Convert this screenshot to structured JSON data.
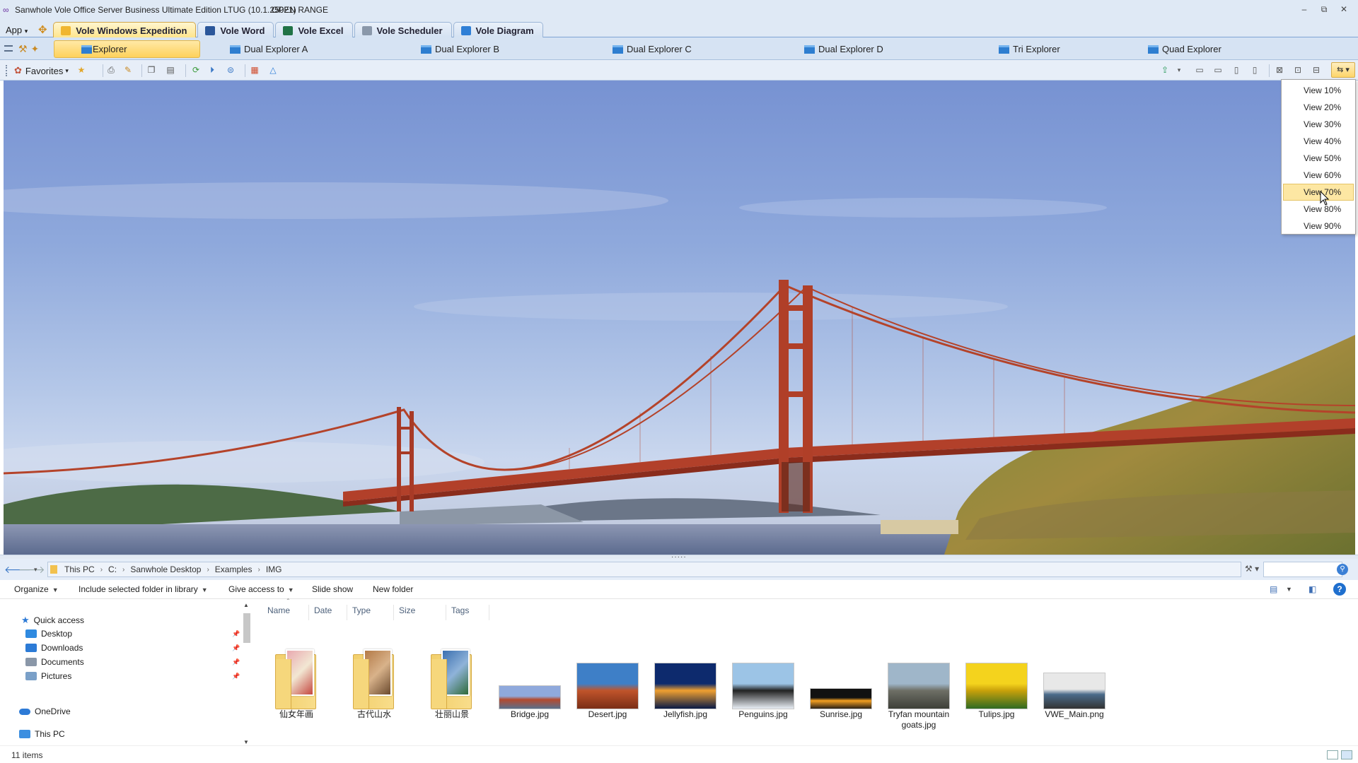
{
  "window": {
    "title": "Sanwhole Vole Office Server Business Ultimate Edition LTUG (10.1.25021)",
    "title_extra": "OPEN RANGE",
    "controls": [
      "–",
      "⧉",
      "✕"
    ]
  },
  "app_menu": {
    "label": "App",
    "caret": "▾"
  },
  "app_tabs": [
    {
      "label": "Vole Windows Expedition",
      "active": true,
      "icon_color": "#f0b630"
    },
    {
      "label": "Vole Word",
      "active": false,
      "icon_color": "#2b579a"
    },
    {
      "label": "Vole Excel",
      "active": false,
      "icon_color": "#217346"
    },
    {
      "label": "Vole Scheduler",
      "active": false,
      "icon_color": "#8a98aa"
    },
    {
      "label": "Vole Diagram",
      "active": false,
      "icon_color": "#2f7fd6"
    }
  ],
  "explorer_tabs": [
    {
      "label": "Explorer",
      "active": true
    },
    {
      "label": "Dual Explorer A",
      "active": false
    },
    {
      "label": "Dual Explorer B",
      "active": false
    },
    {
      "label": "Dual Explorer C",
      "active": false
    },
    {
      "label": "Dual Explorer D",
      "active": false
    },
    {
      "label": "Tri Explorer",
      "active": false
    },
    {
      "label": "Quad Explorer",
      "active": false
    }
  ],
  "toolbar": {
    "favorites_label": "Favorites",
    "favorites_caret": "▾"
  },
  "zoom_menu": {
    "items": [
      "View 10%",
      "View 20%",
      "View 30%",
      "View 40%",
      "View 50%",
      "View 60%",
      "View 70%",
      "View 80%",
      "View 90%"
    ],
    "highlighted": "View 70%"
  },
  "address": {
    "crumbs": [
      "This PC",
      "C:",
      "Sanwhole Desktop",
      "Examples",
      "IMG"
    ],
    "separator": "›"
  },
  "commands": {
    "organize": "Organize",
    "include": "Include selected folder in library",
    "give_access": "Give access to",
    "slideshow": "Slide show",
    "new_folder": "New folder",
    "help": "?"
  },
  "nav": {
    "quick_access": "Quick access",
    "items": [
      {
        "label": "Desktop",
        "pinned": true,
        "icon_color": "#2f8ae0"
      },
      {
        "label": "Downloads",
        "pinned": true,
        "icon_color": "#2c7bd6"
      },
      {
        "label": "Documents",
        "pinned": true,
        "icon_color": "#8a97a8"
      },
      {
        "label": "Pictures",
        "pinned": true,
        "icon_color": "#7aa0c8"
      }
    ],
    "onedrive": "OneDrive",
    "this_pc": "This PC"
  },
  "columns": [
    "Name",
    "Date",
    "Type",
    "Size",
    "Tags"
  ],
  "files": [
    {
      "name": "仙女年画",
      "kind": "folder",
      "art": [
        "#e9a9b0",
        "#f2e7d3",
        "#c4473f"
      ]
    },
    {
      "name": "古代山水",
      "kind": "folder",
      "art": [
        "#b47a47",
        "#d8b28a",
        "#6b4a2e"
      ]
    },
    {
      "name": "壮丽山景",
      "kind": "folder",
      "art": [
        "#3b6fb0",
        "#8fb3d9",
        "#2f6a38"
      ]
    },
    {
      "name": "Bridge.jpg",
      "kind": "image",
      "art": [
        "#8fa9dc",
        "#b44a2f",
        "#5a6f8a"
      ]
    },
    {
      "name": "Desert.jpg",
      "kind": "image",
      "art": [
        "#3e7fc7",
        "#c0542b",
        "#7a2e16"
      ]
    },
    {
      "name": "Jellyfish.jpg",
      "kind": "image",
      "art": [
        "#0d2a6d",
        "#f0a030",
        "#0a1a45"
      ]
    },
    {
      "name": "Penguins.jpg",
      "kind": "image",
      "art": [
        "#9cc4e6",
        "#222",
        "#e8eef4"
      ]
    },
    {
      "name": "Sunrise.jpg",
      "kind": "image",
      "art": [
        "#111",
        "#f5a020",
        "#2a2016"
      ]
    },
    {
      "name": "Tryfan mountain goats.jpg",
      "kind": "image",
      "art": [
        "#9fb6c9",
        "#6e6f66",
        "#3d3f38"
      ]
    },
    {
      "name": "Tulips.jpg",
      "kind": "image",
      "art": [
        "#f4d31d",
        "#c9a10a",
        "#2f6a22"
      ]
    },
    {
      "name": "VWE_Main.png",
      "kind": "image",
      "art": [
        "#e8e8e8",
        "#4a6a8a",
        "#333"
      ]
    }
  ],
  "status": {
    "item_count": "11 items"
  }
}
